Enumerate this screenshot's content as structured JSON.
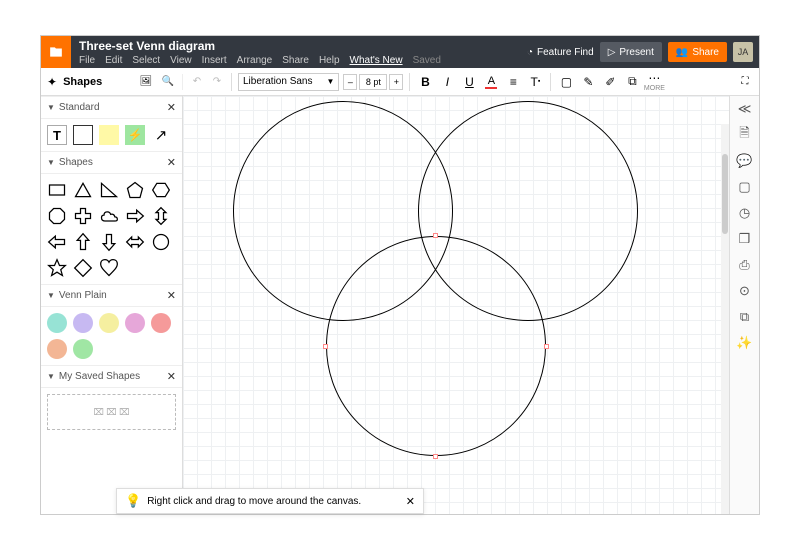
{
  "header": {
    "doc_title": "Three-set Venn diagram",
    "menu": {
      "file": "File",
      "edit": "Edit",
      "select": "Select",
      "view": "View",
      "insert": "Insert",
      "arrange": "Arrange",
      "share": "Share",
      "help": "Help",
      "whats_new": "What's New",
      "saved": "Saved"
    },
    "feature_find": "Feature Find",
    "present": "Present",
    "share_btn": "Share",
    "avatar": "JA"
  },
  "toolbar": {
    "shapes_label": "Shapes",
    "font": "Liberation Sans",
    "size": "8 pt",
    "more": "MORE"
  },
  "panels": {
    "standard": "Standard",
    "shapes": "Shapes",
    "venn": "Venn Plain",
    "saved": "My Saved Shapes"
  },
  "venn_colors": [
    "#97e3d5",
    "#c7b9f2",
    "#f5efa0",
    "#e6a7d9",
    "#f59a9a",
    "#f3b695",
    "#a0e6a4"
  ],
  "tip": {
    "text": "Right click and drag to move around the canvas."
  }
}
